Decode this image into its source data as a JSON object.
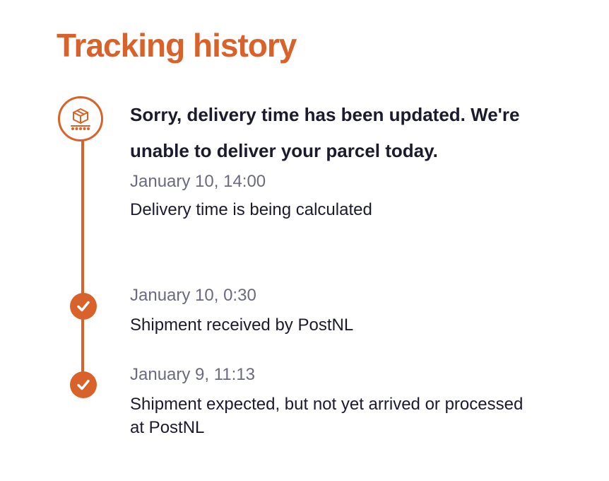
{
  "title": "Tracking history",
  "colors": {
    "accent": "#d9622b",
    "text": "#1c1b2e",
    "muted": "#6b6b80"
  },
  "events": [
    {
      "icon": "parcel-conveyor-icon",
      "headline": "Sorry, delivery time has been updated. We're unable to deliver your parcel today.",
      "date": "January 10, 14:00",
      "description": "Delivery time is being calculated"
    },
    {
      "icon": "checkmark-icon",
      "date": "January 10, 0:30",
      "description": "Shipment received by PostNL"
    },
    {
      "icon": "checkmark-icon",
      "date": "January 9, 11:13",
      "description": "Shipment expected, but not yet arrived or processed at PostNL"
    }
  ]
}
